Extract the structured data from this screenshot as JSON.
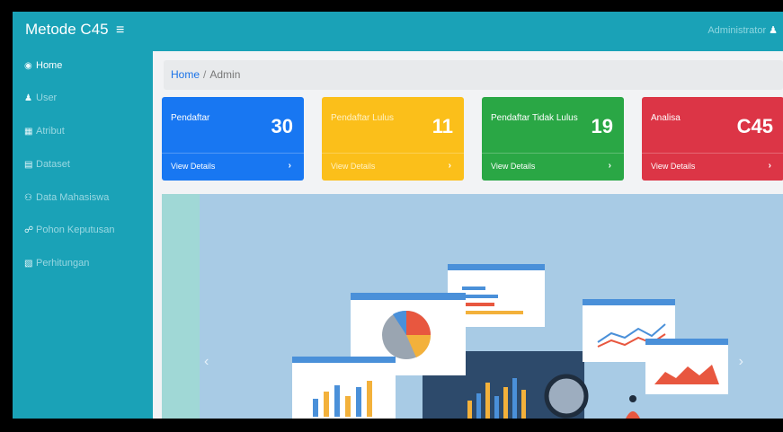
{
  "header": {
    "brand": "Metode C45",
    "menu_icon": "hamburger-icon",
    "user_label": "Administrator",
    "user_icon": "user-icon",
    "color": "#1aa2b7"
  },
  "sidebar": {
    "items": [
      {
        "label": "Home",
        "icon": "dashboard-icon",
        "active": true
      },
      {
        "label": "User",
        "icon": "user-icon"
      },
      {
        "label": "Atribut",
        "icon": "table-icon"
      },
      {
        "label": "Dataset",
        "icon": "database-icon"
      },
      {
        "label": "Data Mahasiswa",
        "icon": "users-icon"
      },
      {
        "label": "Pohon Keputusan",
        "icon": "tree-icon"
      },
      {
        "label": "Perhitungan",
        "icon": "calculator-icon"
      }
    ]
  },
  "breadcrumb": {
    "home": "Home",
    "separator": "/",
    "current": "Admin"
  },
  "cards": [
    {
      "label": "Pendaftar",
      "value": "30",
      "footer": "View Details",
      "color": "#1877f2"
    },
    {
      "label": "Pendaftar Lulus",
      "value": "11",
      "footer": "View Details",
      "color": "#fbbf1a"
    },
    {
      "label": "Pendaftar Tidak Lulus",
      "value": "19",
      "footer": "View Details",
      "color": "#2aa745"
    },
    {
      "label": "Analisa",
      "value": "C45",
      "footer": "View Details",
      "color": "#dc3546"
    }
  ],
  "carousel": {
    "prev_icon": "chevron-left-icon",
    "next_icon": "chevron-right-icon",
    "prev_glyph": "‹",
    "next_glyph": "›",
    "chevron": "›"
  }
}
